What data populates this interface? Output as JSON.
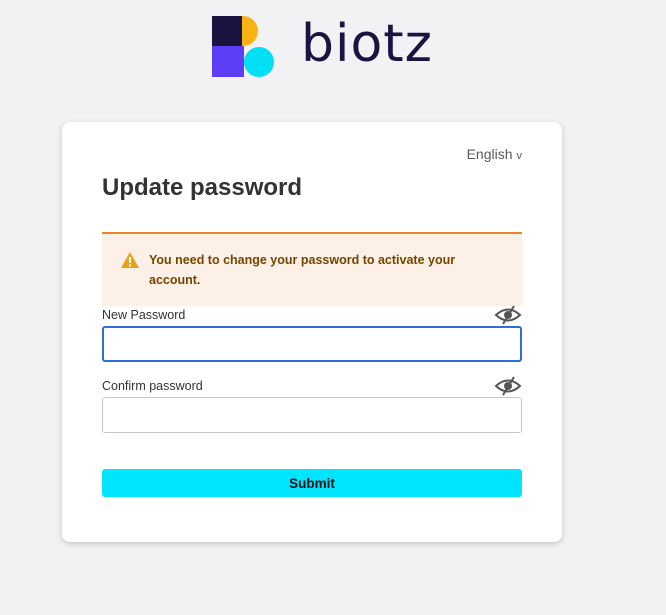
{
  "brand": {
    "name": "biotz",
    "colors": {
      "navy": "#1a1440",
      "yellow": "#f9b214",
      "purple": "#5b3ef5",
      "cyan": "#00e0f5"
    }
  },
  "form": {
    "language": "English",
    "language_icon": "chevron-down-icon",
    "title": "Update password",
    "alert": {
      "icon": "warning-icon",
      "message": "You need to change your password to activate your account."
    },
    "new_password": {
      "label": "New Password",
      "value": "",
      "toggle_icon": "eye-off-icon"
    },
    "confirm_password": {
      "label": "Confirm password",
      "value": "",
      "toggle_icon": "eye-off-icon"
    },
    "submit_label": "Submit"
  },
  "colors": {
    "accent": "#00e5ff",
    "focus": "#2c6fd6",
    "alert_border": "#e8862a",
    "alert_bg": "#fdf0e6",
    "alert_text": "#734500"
  }
}
